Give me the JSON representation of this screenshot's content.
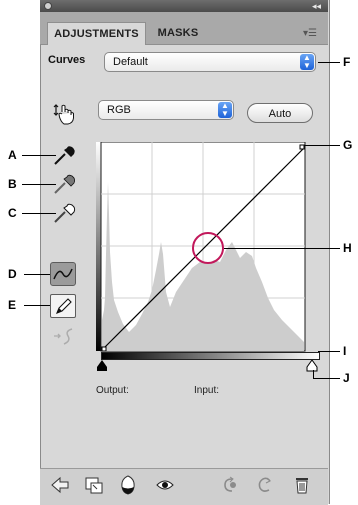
{
  "tabs": {
    "adjustments": "ADJUSTMENTS",
    "masks": "MASKS"
  },
  "preset": {
    "label": "Curves",
    "value": "Default"
  },
  "channel": {
    "value": "RGB"
  },
  "auto_button": "Auto",
  "readouts": {
    "output_label": "Output:",
    "input_label": "Input:"
  },
  "callouts": [
    "A",
    "B",
    "C",
    "D",
    "E",
    "F",
    "G",
    "H",
    "I",
    "J"
  ],
  "colors": {
    "panel": "#d8d8d8",
    "tabbar": "#a9a9a9",
    "select_arrow": "#2f6fe0",
    "highlight_circle": "#c2185b"
  }
}
